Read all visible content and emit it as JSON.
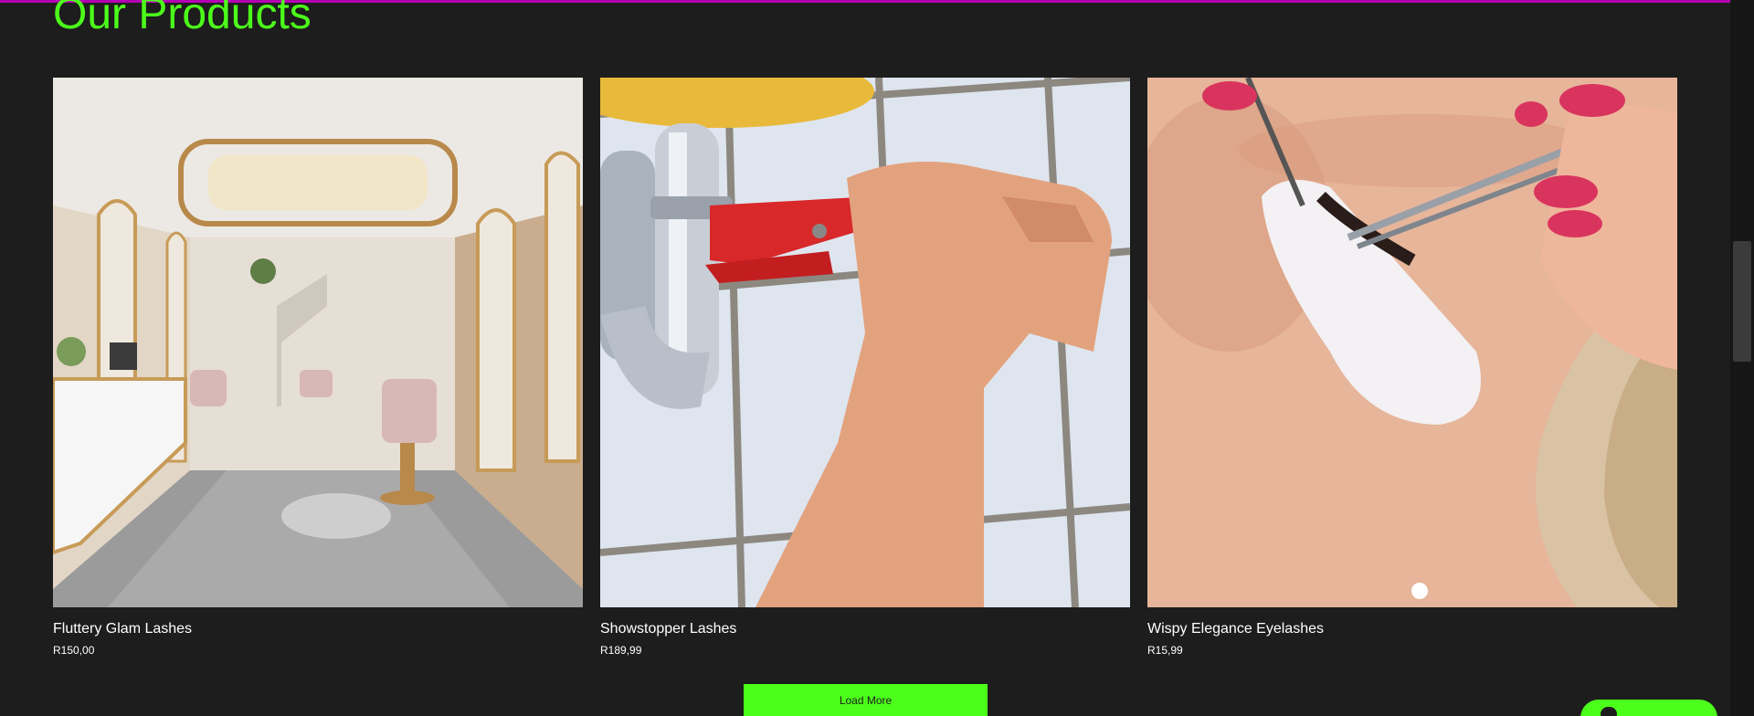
{
  "section": {
    "title": "Our Products"
  },
  "products": [
    {
      "name": "Fluttery Glam Lashes",
      "price": "R150,00",
      "image": "salon-interior-photo"
    },
    {
      "name": "Showstopper Lashes",
      "price": "R189,99",
      "image": "plumber-wrench-photo"
    },
    {
      "name": "Wispy Elegance Eyelashes",
      "price": "R15,99",
      "image": "eyelash-extension-photo"
    }
  ],
  "load_more": {
    "label": "Load More"
  },
  "colors": {
    "background": "#1d1d1d",
    "accent": "#4cff1a",
    "top_border": "#b300b3",
    "text": "#ffffff"
  }
}
